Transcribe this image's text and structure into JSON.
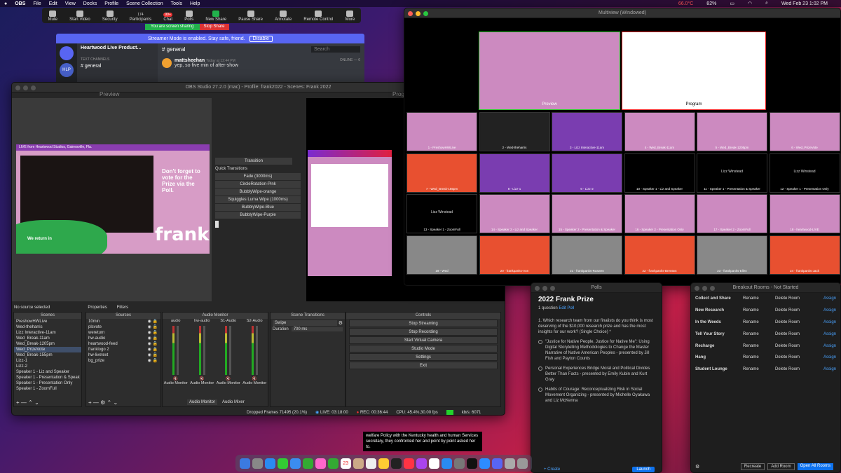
{
  "menubar": {
    "app": "OBS",
    "items": [
      "File",
      "Edit",
      "View",
      "Docks",
      "Profile",
      "Scene Collection",
      "Tools",
      "Help"
    ],
    "battery": "66.0°C",
    "pct": "82%",
    "clock": "Wed Feb 23  1:02 PM"
  },
  "zoom": {
    "items": [
      "Mute",
      "Start Video",
      "Security",
      "Participants",
      "Chat",
      "Polls",
      "New Share",
      "Pause Share",
      "Annotate",
      "Remote Control",
      "More"
    ],
    "participants_count": "174",
    "chat_badge": "99+",
    "sharing": "You are screen sharing",
    "stop_share": "Stop Share"
  },
  "discord": {
    "banner": "Streamer Mode is enabled. Stay safe, friend.",
    "disable": "Disable",
    "server": "Heartwood Live Product...",
    "channel": "general",
    "search": "Search",
    "text_channels": "TEXT CHANNELS",
    "chan_item": "general",
    "user": "mattsheehan",
    "time": "Today at 12:44 PM",
    "message": "yep, so five min of after-show",
    "online": "ONLINE — 6",
    "server_badge": "HLP"
  },
  "obs": {
    "title": "OBS Studio 27.2.0 (mac) - Profile: frank2022 - Scenes: Frank 2022",
    "preview": "Preview",
    "program": "Progr",
    "transition_panel": {
      "header": "Transition",
      "quick": "Quick Transitions",
      "items": [
        "Fade (3000ms)",
        "CircleRotation-Pink",
        "BubblyWipe-orange",
        "Squiggles Luma Wipe (1000ms)",
        "BubblyWipe-Blue",
        "BubblyWipe-Purple"
      ]
    },
    "no_source": "No source selected",
    "properties": "Properties",
    "filters": "Filters",
    "scenes_header": "Scenes",
    "scenes": [
      "PreshowHWLive",
      "Wed-theharris",
      "Lizz Interactive-11am",
      "Wed_Break-11am",
      "Wed_Break-1205pm",
      "Wed_PrizeVote",
      "Wed_Break-155pm",
      "Lizz-1",
      "Lizz-2",
      "Speaker 1 - Liz and Speaker",
      "Speaker 1 - Presentation & Speak",
      "Speaker 1 - Presentation Only",
      "Speaker 1 - ZoomFull"
    ],
    "selected_scene": 5,
    "sources_header": "Sources",
    "sources": [
      "10min",
      "plsvote",
      "wereturn",
      "hw-audio",
      "heartwood-feed",
      "franklogo 2",
      "hw-livetext",
      "bg_prize"
    ],
    "audio_header": "Audio Monitor",
    "channels": [
      "audio",
      "hw-audio",
      "S1-Audio",
      "S2-Audio"
    ],
    "ch_label": "Audio Monitor",
    "audio_tabs": [
      "Audio Monitor",
      "Audio Mixer"
    ],
    "st_header": "Scene Transitions",
    "st_value": "Swipe",
    "duration_label": "Duration",
    "duration": "700 ms",
    "controls_header": "Controls",
    "controls": [
      "Stop Streaming",
      "Stop Recording",
      "Start Virtual Camera",
      "Studio Mode",
      "Settings",
      "Exit"
    ],
    "status": {
      "dropped": "Dropped Frames 71495 (20.1%)",
      "live": "LIVE: 03:18:00",
      "rec": "REC: 00:36:44",
      "cpu": "CPU: 45.4%,30.00 fps",
      "kbps": "kb/s: 6071"
    },
    "scene_text": {
      "top": "LIVE from Heartwood Studios, Gainesville, Fla.",
      "vote": "Don't forget to vote for the Prize via the Poll.",
      "return": "We return in",
      "logo": "frank"
    }
  },
  "multiview": {
    "title": "Multiview (Windowed)",
    "preview": "Preview",
    "program": "Program",
    "tiles": [
      "1 - PreshowHWLive",
      "2 - Wed-theharris",
      "3 - Lizz Interactive-11am",
      "4 - Wed_Break-11am",
      "5 - Wed_Break-1205pm",
      "6 - Wed_PrizeVote",
      "7 - Wed_Break-155pm",
      "8 - Lizz-1",
      "9 - Lizz-2",
      "10 - Speaker 1 - Liz and Speaker",
      "11 - Speaker 1 - Presentation & Speaker",
      "12 - Speaker 1 - Presentation Only",
      "13 - Speaker 1 - ZoomFull",
      "14 - Speaker 2 - Liz and Speaker",
      "15 - Speaker 2 - Presentation & Speaker",
      "16 - Speaker 2 - Presentation Only",
      "17 - Speaker 2 - ZoomFull",
      "18 - heartwood-LIVE",
      "19 - Wed",
      "20 - frankpanks-Ann",
      "21 - frankpanks-Ruswen",
      "22 - frankpanks-Brentwn",
      "23 - frankpanks-Ellen",
      "24 - frankpanks-Jack"
    ],
    "liz": "Lizz Winstead"
  },
  "polls": {
    "title": "Polls",
    "heading": "2022 Frank Prize",
    "meta": "1 question",
    "edit": "Edit Poll",
    "question": "1. Which research team from our finalists do you think is most deserving of the $10,000 research prize and has the most insights for our work? (Single Choice) *",
    "options": [
      "\"Justice for Native People, Justice for Native Me\": Using Digital Storytelling Methodologies to Change the Master Narrative of Native American Peoples - presented by Jill Fish and Payton Counts",
      "Personal Experiences Bridge Moral and Political Divides Better Than Facts - presented by Emily Kubin and Kurt Gray",
      "Habits of Courage: Reconceptualizing Risk in Social Movement Organizing - presented by Michelle Oyakawa and Liz McKenna"
    ],
    "create": "+ Create",
    "launch": "Launch"
  },
  "breakout": {
    "title": "Breakout Rooms - Not Started",
    "rooms": [
      "Collect and Share",
      "New Research",
      "In the Weeds",
      "Tell Your Story",
      "Recharge",
      "Hang",
      "Student Lounge"
    ],
    "rename": "Rename",
    "delete": "Delete Room",
    "assign": "Assign",
    "recreate": "Recreate",
    "add": "Add Room",
    "open": "Open All Rooms"
  },
  "caption": "welfare Policy with the Kentucky health and human Services secretary, they confronted her and point by point asked her to.",
  "dock_date": "23"
}
